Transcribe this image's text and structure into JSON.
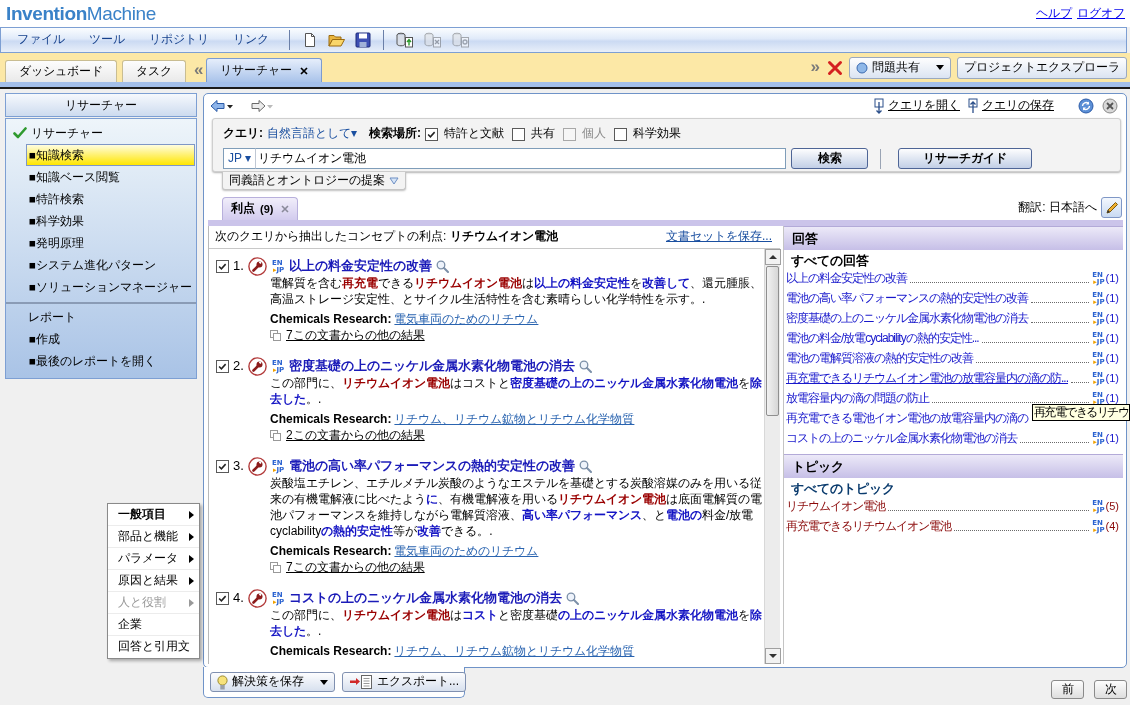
{
  "header": {
    "logo": "**Invention**Machine",
    "links": [
      "ヘルプ",
      "ログオフ"
    ]
  },
  "menu": [
    "ファイル",
    "ツール",
    "リポジトリ",
    "リンク"
  ],
  "toolbar": [
    {
      "disabled": false
    },
    {
      "disabled": false
    },
    {
      "disabled": false
    },
    {
      "disabled": false
    },
    {
      "disabled": true
    },
    {
      "disabled": true
    }
  ],
  "tab_strip": [
    {
      "kind": "tab",
      "label": "ダッシュボード",
      "selected": false,
      "closable": false
    },
    {
      "kind": "tab",
      "label": "タスク",
      "selected": false,
      "closable": false
    },
    {
      "kind": "scroll",
      "label": "«"
    },
    {
      "kind": "tab",
      "label": "リサーチャー",
      "selected": true,
      "closable": true
    }
  ],
  "tab_tools": {
    "scroll": "»",
    "actions": [
      {
        "kind": "dropdown",
        "label": "問題共有"
      },
      {
        "kind": "button",
        "label": "プロジェクトエクスプローラ"
      }
    ]
  },
  "sidebar": {
    "title": "リサーチャー",
    "groups": [
      {
        "label": "リサーチャー",
        "checked": true,
        "children": [
          {
            "label": "■知識検索",
            "selected": true
          },
          {
            "label": "■知識ベース閲覧",
            "selected": false
          },
          {
            "label": "■特許検索",
            "selected": false
          },
          {
            "label": "■科学効果",
            "selected": false
          },
          {
            "label": "■発明原理",
            "selected": false
          },
          {
            "label": "■システム進化パターン",
            "selected": false
          },
          {
            "label": "■ソリューションマネージャー",
            "selected": false
          }
        ]
      },
      {
        "label": "レポート",
        "checked": false,
        "children": [
          {
            "label": "■作成",
            "selected": false
          },
          {
            "label": "■最後のレポートを開く",
            "selected": false
          }
        ]
      }
    ]
  },
  "panel": {
    "links": [
      "クエリを開く",
      "クエリの保存"
    ]
  },
  "query": {
    "label": "クエリ:",
    "mode": "自然言語として▾",
    "scope_label": "検索場所:",
    "scopes": [
      {
        "label": "特許と文献",
        "checked": true,
        "disabled": false
      },
      {
        "label": "共有",
        "checked": false,
        "disabled": false
      },
      {
        "label": "個人",
        "checked": false,
        "disabled": true
      },
      {
        "label": "科学効果",
        "checked": false,
        "disabled": false
      }
    ],
    "language": "JP ▾",
    "value": "リチウムイオン電池",
    "buttons": [
      "検索",
      "リサーチガイド"
    ],
    "suggestions": "同義語とオントロジーの提案"
  },
  "result_tabs": [
    {
      "label": "利点",
      "count": "(9)",
      "selected": true,
      "closable": true
    }
  ],
  "translation": "翻訳: 日本語へ",
  "results_header": {
    "text": "次のクエリから抽出したコンセプトの利点: **リチウムイオン電池**",
    "link": "文書セットを保存..."
  },
  "results": [
    {
      "number": "1.",
      "checked": true,
      "language": {
        "from": "EN",
        "arrow": "▸",
        "to": "JP"
      },
      "title": "以上の料金安定性の改善",
      "body": [
        {
          "kind": "plain",
          "text": "電解質を含む"
        },
        {
          "kind": "concept",
          "text": "再充電"
        },
        {
          "kind": "plain",
          "text": "できる"
        },
        {
          "kind": "concept",
          "text": "リチウムイオン電池"
        },
        {
          "kind": "plain",
          "text": "は"
        },
        {
          "kind": "answer",
          "text": "以上の料金安定性"
        },
        {
          "kind": "plain",
          "text": "を"
        },
        {
          "kind": "answer",
          "text": "改善して"
        },
        {
          "kind": "plain",
          "text": "、還元腫脹、高温ストレージ安定性、とサイクル生活特性を含む素晴らしい化学特性を示す。."
        }
      ],
      "source_label": "Chemicals Research:",
      "source": "電気車両のためのリチウム",
      "more": "7この文書からの他の結果"
    },
    {
      "number": "2.",
      "checked": true,
      "language": {
        "from": "EN",
        "arrow": "▸",
        "to": "JP"
      },
      "title": "密度基礎の上のニッケル金属水素化物電池の消去",
      "body": [
        {
          "kind": "plain",
          "text": "この部門に、"
        },
        {
          "kind": "concept",
          "text": "リチウムイオン電池"
        },
        {
          "kind": "plain",
          "text": "はコストと"
        },
        {
          "kind": "answer",
          "text": "密度基礎の上のニッケル金属水素化物電池"
        },
        {
          "kind": "plain",
          "text": "を"
        },
        {
          "kind": "answer",
          "text": "除去した"
        },
        {
          "kind": "plain",
          "text": "。."
        }
      ],
      "source_label": "Chemicals Research:",
      "source": "リチウム、リチウム鉱物とリチウム化学物質",
      "more": "2この文書からの他の結果"
    },
    {
      "number": "3.",
      "checked": true,
      "language": {
        "from": "EN",
        "arrow": "▸",
        "to": "JP"
      },
      "title": "電池の高い率パフォーマンスの熱的安定性の改善",
      "body": [
        {
          "kind": "plain",
          "text": "炭酸塩エチレン、エチルメチル炭酸のようなエステルを基礎とする炭酸溶媒のみを用いる従来の有機電解液に比べたよう"
        },
        {
          "kind": "answer",
          "text": "に"
        },
        {
          "kind": "plain",
          "text": "、有機電解液を用いる"
        },
        {
          "kind": "concept",
          "text": "リチウムイオン電池"
        },
        {
          "kind": "plain",
          "text": "は底面電解質の電池パフォーマンスを維持しながら電解質溶液、"
        },
        {
          "kind": "answer",
          "text": "高い率パフォーマンス"
        },
        {
          "kind": "plain",
          "text": "、と"
        },
        {
          "kind": "answer",
          "text": "電池の"
        },
        {
          "kind": "plain",
          "text": "料金/放電cyclability"
        },
        {
          "kind": "answer",
          "text": "の熱的安定性"
        },
        {
          "kind": "plain",
          "text": "等が"
        },
        {
          "kind": "answer",
          "text": "改善"
        },
        {
          "kind": "plain",
          "text": "できる。."
        }
      ],
      "source_label": "Chemicals Research:",
      "source": "電気車両のためのリチウム",
      "more": "7この文書からの他の結果"
    },
    {
      "number": "4.",
      "checked": true,
      "language": {
        "from": "EN",
        "arrow": "▸",
        "to": "JP"
      },
      "title": "コストの上のニッケル金属水素化物電池の消去",
      "body": [
        {
          "kind": "plain",
          "text": "この部門に、"
        },
        {
          "kind": "concept",
          "text": "リチウムイオン電池"
        },
        {
          "kind": "plain",
          "text": "は"
        },
        {
          "kind": "answer",
          "text": "コスト"
        },
        {
          "kind": "plain",
          "text": "と密度基礎"
        },
        {
          "kind": "answer",
          "text": "の上のニッケル金属水素化物電池"
        },
        {
          "kind": "plain",
          "text": "を"
        },
        {
          "kind": "answer",
          "text": "除去した"
        },
        {
          "kind": "plain",
          "text": "。."
        }
      ],
      "source_label": "Chemicals Research:",
      "source": "リチウム、リチウム鉱物とリチウム化学物質"
    }
  ],
  "answers": {
    "title": "回答",
    "all": "すべての回答",
    "items": [
      {
        "text": "以上の料金安定性の改善",
        "hovered": false,
        "language": {
          "from": "EN",
          "arrow": "▸",
          "to": "JP"
        },
        "count": "(1)"
      },
      {
        "text": "電池の高い率パフォーマンスの熱的安定性の改善",
        "hovered": false,
        "language": {
          "from": "EN",
          "arrow": "▸",
          "to": "JP"
        },
        "count": "(1)"
      },
      {
        "text": "密度基礎の上のニッケル金属水素化物電池の消去",
        "hovered": false,
        "language": {
          "from": "EN",
          "arrow": "▸",
          "to": "JP"
        },
        "count": "(1)"
      },
      {
        "text": "電池の料金/放電cyclabilityの熱的安定性...",
        "hovered": false,
        "language": {
          "from": "EN",
          "arrow": "▸",
          "to": "JP"
        },
        "count": "(1)"
      },
      {
        "text": "電池の電解質溶液の熱的安定性の改善",
        "hovered": false,
        "language": {
          "from": "EN",
          "arrow": "▸",
          "to": "JP"
        },
        "count": "(1)"
      },
      {
        "text": "再充電できるリチウムイオン電池の放電容量内の滴の防...",
        "hovered": true,
        "language": {
          "from": "EN",
          "arrow": "▸",
          "to": "JP"
        },
        "count": "(1)"
      },
      {
        "text": "放電容量内の滴の問題の防止",
        "hovered": false,
        "language": {
          "from": "EN",
          "arrow": "▸",
          "to": "JP"
        },
        "count": "(1)"
      },
      {
        "text": "再充電できる電池イオン電池の放電容量内の滴の",
        "hovered": false
      },
      {
        "text": "コストの上のニッケル金属水素化物電池の消去",
        "hovered": false,
        "language": {
          "from": "EN",
          "arrow": "▸",
          "to": "JP"
        },
        "count": "(1)"
      }
    ]
  },
  "topics": {
    "title": "トピック",
    "all": "すべてのトピック",
    "items": [
      {
        "text": "リチウムイオン電池",
        "language": {
          "from": "EN",
          "arrow": "▸",
          "to": "JP"
        },
        "count": "(5)"
      },
      {
        "text": "再充電できるリチウムイオン電池",
        "language": {
          "from": "EN",
          "arrow": "▸",
          "to": "JP"
        },
        "count": "(4)"
      }
    ]
  },
  "tooltip": "再充電できるリチウ",
  "context_menu": [
    {
      "label": "一般項目",
      "selected": true,
      "submenu": true,
      "disabled": false
    },
    {
      "label": "部品と機能",
      "selected": false,
      "submenu": true,
      "disabled": false
    },
    {
      "label": "パラメータ",
      "selected": false,
      "submenu": true,
      "disabled": false
    },
    {
      "label": "原因と結果",
      "selected": false,
      "submenu": true,
      "disabled": false
    },
    {
      "label": "人と役割",
      "selected": false,
      "submenu": true,
      "disabled": true
    },
    {
      "label": "企業",
      "selected": false,
      "submenu": false,
      "disabled": false
    },
    {
      "label": "回答と引用文",
      "selected": false,
      "submenu": false,
      "disabled": false
    }
  ],
  "footer": {
    "actions": [
      {
        "kind": "save",
        "label": "解決策を保存"
      },
      {
        "kind": "export",
        "label": "エクスポート..."
      }
    ],
    "pager": [
      "前",
      "次"
    ]
  }
}
